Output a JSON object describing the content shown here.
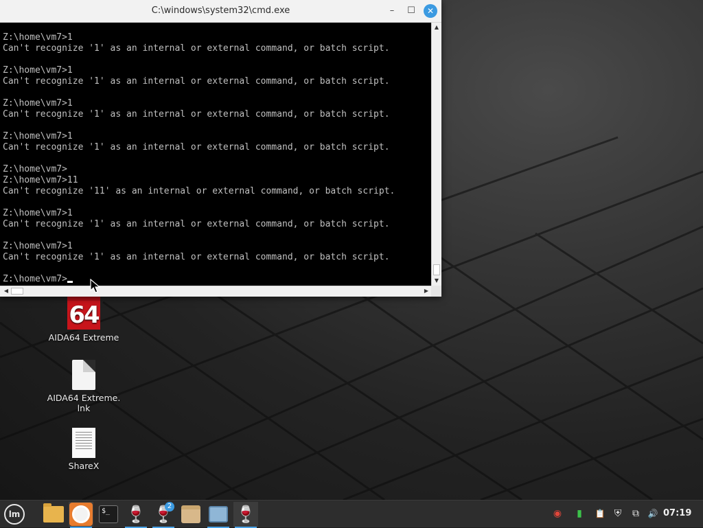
{
  "window": {
    "title": "C:\\windows\\system32\\cmd.exe",
    "minimize_label": "–",
    "maximize_label": "☐",
    "close_label": "✕"
  },
  "console": {
    "lines": [
      "Z:\\home\\vm7>1",
      "Can't recognize '1' as an internal or external command, or batch script.",
      "",
      "Z:\\home\\vm7>1",
      "Can't recognize '1' as an internal or external command, or batch script.",
      "",
      "Z:\\home\\vm7>1",
      "Can't recognize '1' as an internal or external command, or batch script.",
      "",
      "Z:\\home\\vm7>1",
      "Can't recognize '1' as an internal or external command, or batch script.",
      "",
      "Z:\\home\\vm7>",
      "Z:\\home\\vm7>11",
      "Can't recognize '11' as an internal or external command, or batch script.",
      "",
      "Z:\\home\\vm7>1",
      "Can't recognize '1' as an internal or external command, or batch script.",
      "",
      "Z:\\home\\vm7>1",
      "Can't recognize '1' as an internal or external command, or batch script.",
      ""
    ],
    "prompt": "Z:\\home\\vm7>"
  },
  "desktop_icons": [
    {
      "label": "AIDA64 Extreme",
      "icon_text": "64",
      "icon": "aida64-icon"
    },
    {
      "label": "AIDA64 Extreme.\nlnk",
      "icon": "file-icon"
    },
    {
      "label": "ShareX",
      "icon": "document-icon"
    }
  ],
  "taskbar": {
    "items": [
      {
        "name": "menu",
        "icon": "linux-mint-menu-icon",
        "glyph": "lm"
      },
      {
        "name": "files",
        "icon": "folder-icon"
      },
      {
        "name": "firefox",
        "icon": "firefox-icon"
      },
      {
        "name": "terminal",
        "icon": "terminal-icon",
        "glyph": "$_"
      },
      {
        "name": "wine-1",
        "icon": "wine-glasses-icon",
        "glyph": "🍷"
      },
      {
        "name": "wine-2",
        "icon": "wine-glass-icon",
        "glyph": "🍷",
        "badge": "2"
      },
      {
        "name": "archive",
        "icon": "archive-box-icon"
      },
      {
        "name": "installer",
        "icon": "installer-icon"
      },
      {
        "name": "wine-active",
        "icon": "wine-glass-icon",
        "glyph": "🍷"
      }
    ],
    "tray": [
      {
        "icon": "chrome-icon",
        "glyph": "◉"
      },
      {
        "icon": "battery-icon",
        "glyph": "▮"
      },
      {
        "icon": "clipboard-icon",
        "glyph": "📋"
      },
      {
        "icon": "shield-icon",
        "glyph": "⛨"
      },
      {
        "icon": "network-icon",
        "glyph": "⧉"
      },
      {
        "icon": "volume-icon",
        "glyph": "🔊"
      }
    ],
    "clock": "07:19"
  },
  "colors": {
    "close_button": "#3b9ae1",
    "console_bg": "#000000",
    "console_fg": "#c0c0c0",
    "aida_red": "#c8141b"
  }
}
